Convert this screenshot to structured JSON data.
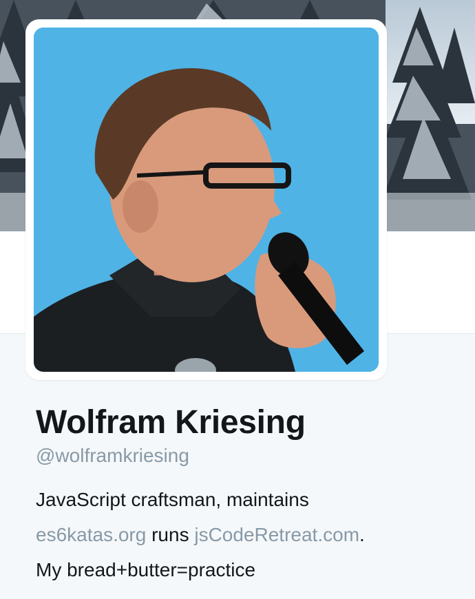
{
  "profile": {
    "name": "Wolfram Kriesing",
    "handle": "@wolframkriesing",
    "bio": {
      "line1": "JavaScript craftsman, maintains",
      "link1": "es6katas.org",
      "middle": " runs ",
      "link2": "jsCodeRetreat.com",
      "end": ".",
      "line3": "My bread+butter=practice"
    }
  },
  "colors": {
    "name": "#14171a",
    "muted_link": "#8899a6",
    "page_bg": "#f5f8fa",
    "avatar_sky": "#4fb3e6"
  }
}
